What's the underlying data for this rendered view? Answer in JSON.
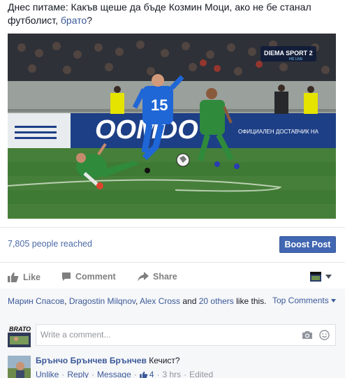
{
  "post": {
    "text": "Днес питаме: Какъв щеше да бъде Козмин Моци, ако не бе станал футболист, ",
    "link": "брато",
    "text_end": "?"
  },
  "video": {
    "channel_logo": "DIEMA SPORT 2",
    "channel_sub": "HD LIVE",
    "jersey_number": "15",
    "banner_text": "OOMDO",
    "banner_text_right": "ОФИЦИАЛЕН ДОСТАВЧИК НА"
  },
  "stats": {
    "reached": "7,805 people reached",
    "boost_label": "Boost Post"
  },
  "actions": {
    "like": "Like",
    "comment": "Comment",
    "share": "Share"
  },
  "likes": {
    "name1": "Марин Спасов",
    "name2": "Dragostin Milqnov",
    "name3": "Alex Cross",
    "and": "and",
    "others": "20 others",
    "suffix": "like this.",
    "sep": ", "
  },
  "top_comments": "Top Comments",
  "write_comment": {
    "placeholder": "Write a comment...",
    "avatar_text": "BRATO"
  },
  "comment": {
    "author": "Брънчо Брънчев Брънчев",
    "text": "Кечист?",
    "unlike": "Unlike",
    "reply": "Reply",
    "message": "Message",
    "dot": "·",
    "likes_count": "4",
    "time": "3 hrs",
    "edited": "Edited"
  },
  "colors": {
    "link": "#3b5998",
    "boost_bg": "#4267b2",
    "pitch": "#3f7a34",
    "blue_kit": "#1f66d6",
    "green_kit": "#2f8a3c"
  }
}
